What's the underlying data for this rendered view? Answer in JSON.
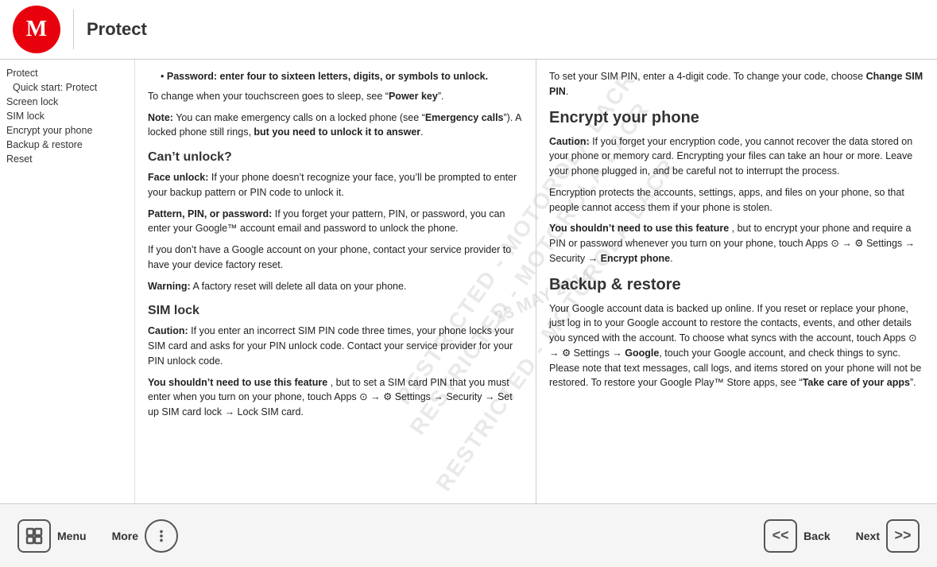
{
  "header": {
    "title": "Protect"
  },
  "sidebar": {
    "items": [
      {
        "id": "protect",
        "label": "Protect",
        "indent": false,
        "active": false
      },
      {
        "id": "quick-start",
        "label": "Quick start: Protect",
        "indent": true,
        "active": false
      },
      {
        "id": "screen-lock",
        "label": "Screen lock",
        "indent": false,
        "active": false
      },
      {
        "id": "sim-lock",
        "label": "SIM lock",
        "indent": false,
        "active": false
      },
      {
        "id": "encrypt",
        "label": "Encrypt your phone",
        "indent": false,
        "active": false
      },
      {
        "id": "backup",
        "label": "Backup & restore",
        "indent": false,
        "active": false
      },
      {
        "id": "reset",
        "label": "Reset",
        "indent": false,
        "active": false
      }
    ]
  },
  "content": {
    "left": {
      "password_bullet": "Password: enter four to sixteen letters, digits, or symbols to unlock.",
      "change_touchscreen": "To change when your touchscreen goes to sleep, see “",
      "power_key": "Power key",
      "change_touchscreen_end": "”.",
      "note_label": "Note:",
      "note_text": " You can make emergency calls on a locked phone (see “",
      "emergency_calls": "Emergency calls",
      "note_text2": "”). A locked phone still rings, ",
      "note_bold": "but you need to unlock it to answer",
      "note_end": ".",
      "cant_unlock": "Can’t unlock?",
      "face_unlock_label": "Face unlock:",
      "face_unlock_text": " If your phone doesn’t recognize your face, you’ll be prompted to enter your backup pattern or PIN code to unlock it.",
      "pattern_label": "Pattern, PIN, or password:",
      "pattern_text": " If you forget your pattern, PIN, or password, you can enter your Google™ account email and password to unlock the phone.",
      "no_google_text": "If you don’t have a Google account on your phone, contact your service provider to have your device factory reset.",
      "warning_label": "Warning:",
      "warning_text": " A factory reset will delete all data on your phone.",
      "sim_lock_heading": "SIM lock",
      "caution_label": "Caution:",
      "caution_text": " If you enter an incorrect SIM PIN code three times, your phone locks your SIM card and asks for your PIN unlock code. Contact your service provider for your PIN unlock code.",
      "shouldnt_label": "You shouldn’t need to use this feature",
      "shouldnt_text": ", but to set a SIM card PIN that you must enter when you turn on your phone, touch Apps ⊙ → ⚙ Settings → Security → Set up SIM card lock → Lock SIM card."
    },
    "right": {
      "sim_pin_text": "To set your SIM PIN, enter a 4-digit code. To change your code, choose ",
      "change_sim_pin": "Change SIM PIN",
      "sim_pin_end": ".",
      "encrypt_heading": "Encrypt your phone",
      "caution_label": "Caution:",
      "caution_text": " If you forget your encryption code, you cannot recover the data stored on your phone or memory card. Encrypting your files can take an hour or more. Leave your phone plugged in, and be careful not to interrupt the process.",
      "encrypt_desc": "Encryption protects the accounts, settings, apps, and files on your phone, so that people cannot access them if your phone is stolen.",
      "shouldnt_label": "You shouldn’t need to use this feature",
      "shouldnt_text": ", but to encrypt your phone and require a PIN or password whenever you turn on your phone, touch Apps ⊙ → ⚙ Settings → Security → ",
      "encrypt_phone": "Encrypt phone",
      "encrypt_phone_end": ".",
      "backup_heading": "Backup & restore",
      "backup_text": "Your Google account data is backed up online. If you reset or replace your phone, just log in to your Google account to restore the contacts, events, and other details you synced with the account. To choose what syncs with the account, touch Apps ⊙ → ⚙ Settings → ",
      "google_bold": "Google",
      "backup_text2": ", touch your Google account, and check things to sync. Please note that text messages, call logs, and items stored on your phone will not be restored. To restore your Google Play™ Store apps, see “",
      "take_care": "Take care of your apps",
      "backup_end": "”."
    }
  },
  "watermark": {
    "line1": "RESTRICTED - MOTOROLA LACR",
    "date": "23 MAY 2014"
  },
  "footer": {
    "menu_label": "Menu",
    "more_label": "More",
    "back_label": "Back",
    "next_label": "Next"
  }
}
